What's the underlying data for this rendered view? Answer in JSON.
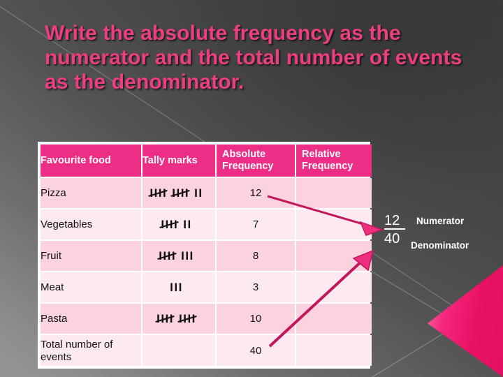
{
  "slide": {
    "title": "Write the absolute frequency as the numerator and the total number of events as the denominator.",
    "title_color": "#ec3e80",
    "background_color": "#4d4d4d",
    "accent_color": "#ed2e86"
  },
  "table": {
    "headers": [
      "Favourite food",
      "Tally marks",
      "Absolute Frequency",
      "Relative Frequency"
    ],
    "header_bg": "#ed2e86",
    "row_bg_dark": "#fbd3de",
    "row_bg_light": "#fde9f0",
    "rows": [
      {
        "food": "Pizza",
        "tally": "卌 卌 II",
        "tally_fives": 2,
        "tally_ones": 2,
        "absolute": "12",
        "relative": ""
      },
      {
        "food": "Vegetables",
        "tally": "卌  II",
        "tally_fives": 1,
        "tally_ones": 2,
        "absolute": "7",
        "relative": ""
      },
      {
        "food": "Fruit",
        "tally": "卌 III",
        "tally_fives": 1,
        "tally_ones": 3,
        "absolute": "8",
        "relative": ""
      },
      {
        "food": "Meat",
        "tally": "III",
        "tally_fives": 0,
        "tally_ones": 3,
        "absolute": "3",
        "relative": ""
      },
      {
        "food": "Pasta",
        "tally": "卌 卌",
        "tally_fives": 2,
        "tally_ones": 0,
        "absolute": "10",
        "relative": ""
      },
      {
        "food": "Total number of events",
        "tally": "",
        "tally_fives": 0,
        "tally_ones": 0,
        "absolute": "40",
        "relative": ""
      }
    ]
  },
  "annotation": {
    "numerator_value": "12",
    "denominator_value": "40",
    "numerator_label": "Numerator",
    "denominator_label": "Denominator",
    "arrow_color": "#c2185b",
    "arrowhead_color": "#ec2f7e"
  }
}
